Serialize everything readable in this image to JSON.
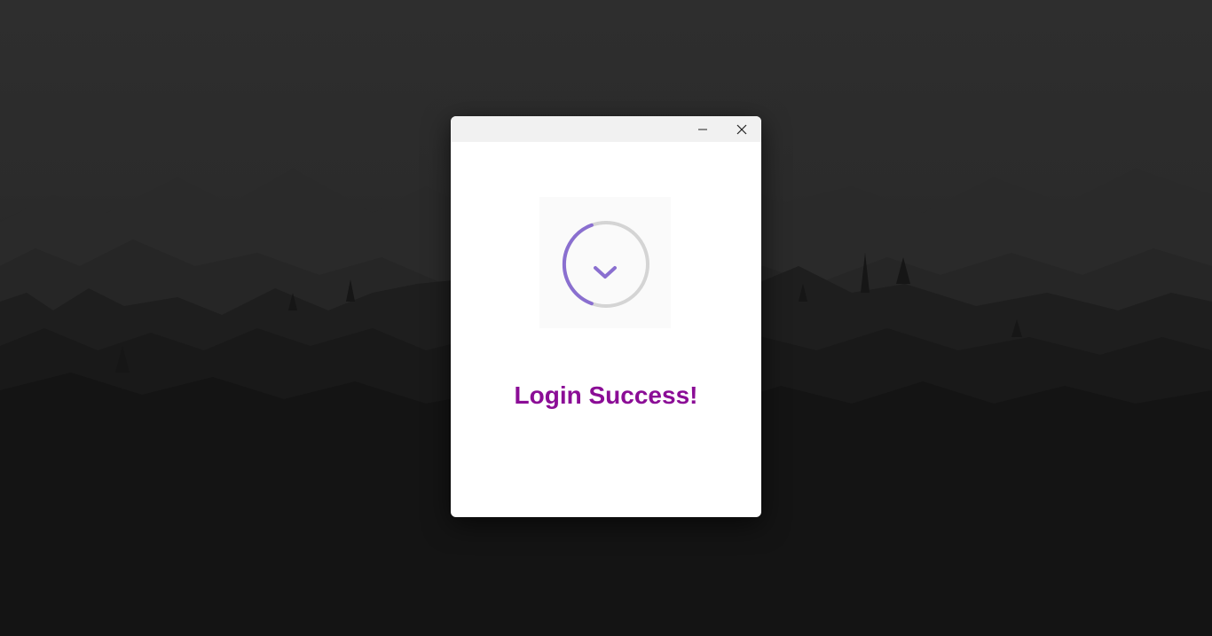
{
  "window": {
    "minimize_icon": "minimize-icon",
    "close_icon": "close-icon"
  },
  "status": {
    "icon": "check-circle-icon",
    "message": "Login Success!",
    "message_color": "#8b0d96",
    "accent_color": "#9370db"
  }
}
